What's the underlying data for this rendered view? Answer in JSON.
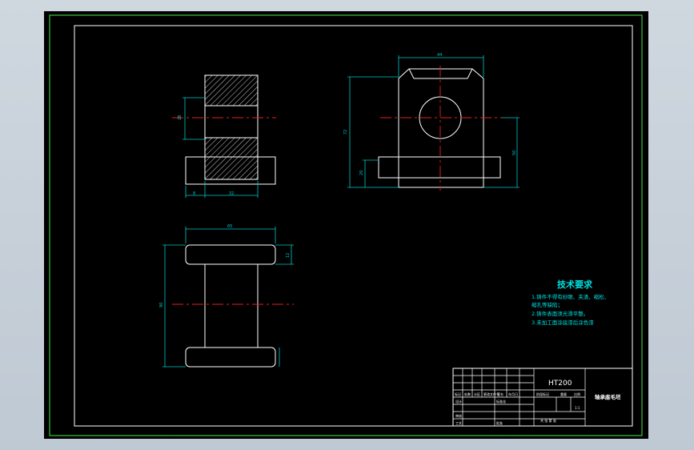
{
  "colors": {
    "outer_border": "#3cc43c",
    "line": "#ffffff",
    "hatch": "#ffffff",
    "center_line": "#e02020",
    "dimension": "#00c8c8",
    "text_cyan": "#00e0e0",
    "title_block": "#ffffff",
    "background": "#000000"
  },
  "notes": {
    "title": "技术要求",
    "lines": [
      "1.铸件不得有砂眼、夹渣、缩松、",
      "缩孔等缺陷；",
      "2.铸件表面须光滑平整。",
      "3.未加工面涂底漆后涂色漆"
    ]
  },
  "title_block": {
    "material": "HT200",
    "part_name": "轴承座毛坯",
    "scale": "1:1",
    "row_labels": [
      "标记",
      "处数",
      "分区",
      "更改文件号",
      "签名",
      "年月日"
    ],
    "left_labels": [
      "设计",
      "审核",
      "工艺"
    ],
    "mid_labels": [
      "标准化",
      "批准",
      "阶段标记",
      "重量",
      "比例"
    ],
    "sheet_text": "共  张  第  张"
  },
  "dimensions": {
    "top_front": "44",
    "top_left_height": "72",
    "top_right_height": "50",
    "top_right_small": "20",
    "side_left_height": "28",
    "side_bottom_left": "8",
    "side_bottom_right": "32",
    "plan_width": "65",
    "plan_height": "90",
    "plan_flange": "12"
  }
}
